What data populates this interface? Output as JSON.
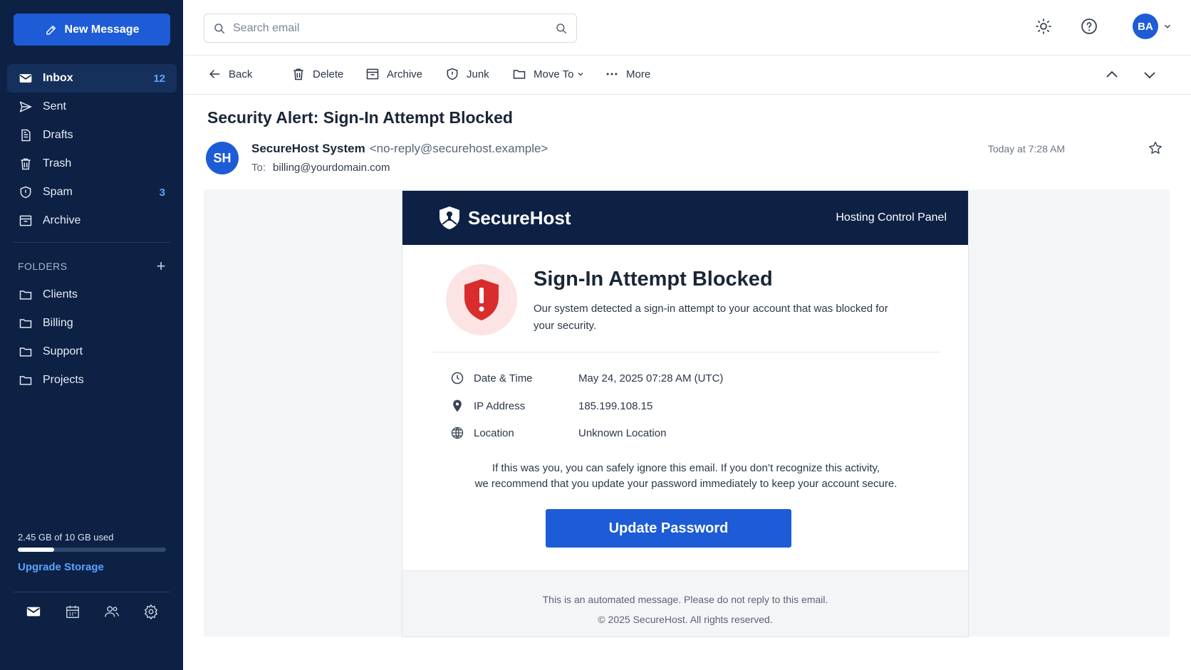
{
  "sidebar": {
    "new_message": "New Message",
    "nav": [
      {
        "label": "Inbox",
        "count": "12",
        "icon": "mail-icon"
      },
      {
        "label": "Sent",
        "count": "",
        "icon": "send-icon"
      },
      {
        "label": "Drafts",
        "count": "",
        "icon": "draft-icon"
      },
      {
        "label": "Trash",
        "count": "",
        "icon": "trash-icon"
      },
      {
        "label": "Spam",
        "count": "3",
        "icon": "shield-icon"
      },
      {
        "label": "Archive",
        "count": "",
        "icon": "archive-icon"
      }
    ],
    "folders_heading": "FOLDERS",
    "folders": [
      "Clients",
      "Billing",
      "Support",
      "Projects"
    ],
    "storage_text": "2.45 GB of 10 GB used",
    "storage_used_fraction": 0.245,
    "upgrade": "Upgrade Storage"
  },
  "topbar": {
    "search_placeholder": "Search email",
    "avatar_initials": "BA"
  },
  "toolbar": {
    "back": "Back",
    "delete": "Delete",
    "archive": "Archive",
    "junk": "Junk",
    "move_to": "Move To",
    "more": "More"
  },
  "email": {
    "subject": "Security Alert: Sign-In Attempt Blocked",
    "sender_initials": "SH",
    "sender_name": "SecureHost System",
    "sender_address": "<no-reply@securehost.example>",
    "to_label": "To:",
    "to_address": "billing@yourdomain.com",
    "time": "Today at 7:28 AM"
  },
  "card": {
    "brand": "SecureHost",
    "panel_label": "Hosting Control Panel",
    "alert_title": "Sign-In Attempt Blocked",
    "alert_desc": "Our system detected a sign-in attempt to your account that was blocked for your security.",
    "details": [
      {
        "label": "Date & Time",
        "value": "May 24, 2025 07:28 AM (UTC)"
      },
      {
        "label": "IP Address",
        "value": "185.199.108.15"
      },
      {
        "label": "Location",
        "value": "Unknown Location"
      }
    ],
    "notice_line1": "If this was you, you can safely ignore this email. If you don’t recognize this activity,",
    "notice_line2": "we recommend that you update your password immediately to keep your account secure.",
    "button": "Update Password",
    "footer_line1": "This is an automated message. Please do not reply to this email.",
    "footer_line2": "© 2025 SecureHost. All rights reserved."
  },
  "colors": {
    "sidebar_bg": "#0c2144",
    "accent": "#1d5cd6",
    "count": "#5ea2ff",
    "alert_red": "#d92d2d"
  }
}
